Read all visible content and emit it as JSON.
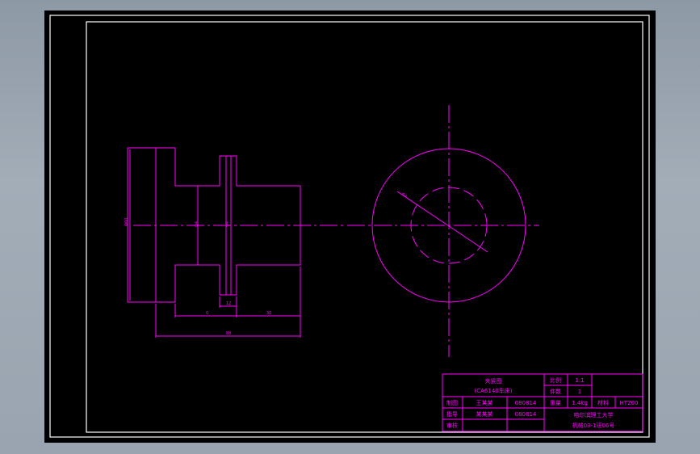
{
  "drawing": {
    "line_color": "#ff00ff",
    "frame_color": "#ffffff",
    "background": "#000000",
    "dimensions": {
      "diameter_left": "Φ60",
      "bore_a": "Φ4",
      "bore_b": "Φ4",
      "len_a": "0",
      "len_b": "12",
      "len_c": "30",
      "overall": "88",
      "circle_dia": "Φ4"
    }
  },
  "title_block": {
    "part_name": "夹紧图",
    "part_sub": "(CA6140车床)",
    "scale_label": "比例",
    "scale_value": "1:1",
    "qty_label": "件数",
    "qty_value": "1",
    "drawn_label": "制图",
    "drawn_name": "王某某",
    "drawn_date": "080814",
    "weight_label": "重量",
    "weight_value": "1.4kg",
    "material_label": "材料",
    "material_value": "HT200",
    "guide_label": "指导",
    "guide_name": "某某某",
    "guide_date": "080814",
    "school": "哈尔滨理工大学",
    "class": "机械03-1班06号",
    "review_label": "审核"
  }
}
